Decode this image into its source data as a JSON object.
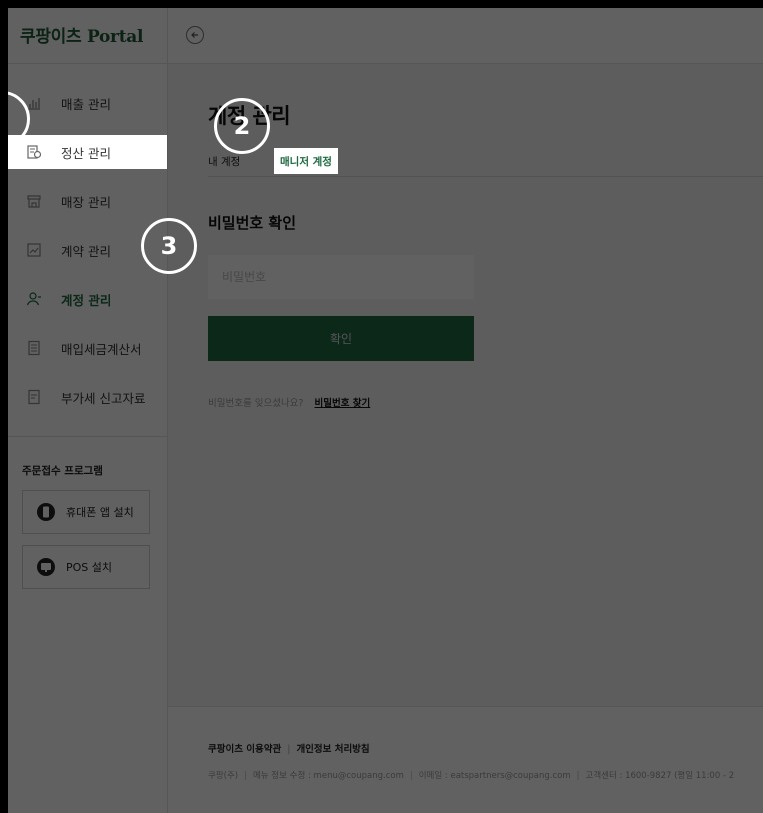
{
  "logo": "쿠팡이츠 Portal",
  "sidebar": {
    "items": [
      {
        "label": "매출 관리",
        "icon": "bar-chart-icon"
      },
      {
        "label": "정산 관리",
        "icon": "settlement-icon"
      },
      {
        "label": "매장 관리",
        "icon": "store-icon"
      },
      {
        "label": "계약 관리",
        "icon": "contract-icon"
      },
      {
        "label": "계정 관리",
        "icon": "account-icon"
      },
      {
        "label": "매입세금계산서",
        "icon": "tax-invoice-icon"
      },
      {
        "label": "부가세 신고자료",
        "icon": "document-icon"
      }
    ],
    "program_title": "주문접수 프로그램",
    "program_buttons": [
      {
        "label": "휴대폰 앱 설치",
        "icon": "phone-icon"
      },
      {
        "label": "POS 설치",
        "icon": "monitor-icon"
      }
    ]
  },
  "main": {
    "title": "계정 관리",
    "tabs": [
      {
        "label": "내 계정"
      },
      {
        "label": "매니저 계정"
      }
    ],
    "section_title": "비밀번호 확인",
    "password_placeholder": "비밀번호",
    "confirm_label": "확인",
    "forgot_question": "비밀번호를 잊으셨나요?",
    "forgot_link": "비밀번호 찾기"
  },
  "footer": {
    "terms": "쿠팡이츠 이용약관",
    "privacy": "개인정보 처리방침",
    "info": [
      "쿠팡(주)",
      "메뉴 정보 수정 : menu@coupang.com",
      "이메일 : eatspartners@coupang.com",
      "고객센터 : 1600-9827 (평일 11:00 - 2"
    ]
  },
  "annotations": {
    "step2": "2",
    "step3": "3"
  },
  "colors": {
    "brand": "#1d6a40",
    "overlay": "rgba(0,0,0,0.62)"
  }
}
